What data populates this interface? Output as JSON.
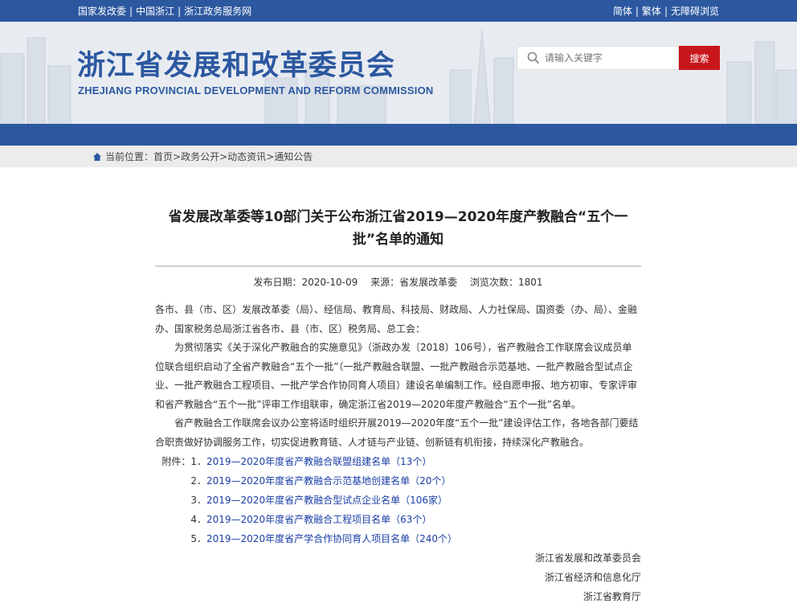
{
  "topbar": {
    "left_links": [
      "国家发改委",
      "中国浙江",
      "浙江政务服务网"
    ],
    "right_links": [
      "简体",
      "繁体",
      "无障碍浏览"
    ]
  },
  "header": {
    "title_cn": "浙江省发展和改革委员会",
    "title_en": "ZHEJIANG PROVINCIAL DEVELOPMENT AND REFORM COMMISSION",
    "search_placeholder": "请输入关键字",
    "search_button": "搜索"
  },
  "breadcrumb": {
    "prefix": "当前位置：",
    "items": [
      "首页",
      "政务公开",
      "动态资讯",
      "通知公告"
    ]
  },
  "article": {
    "title": "省发展改革委等10部门关于公布浙江省2019—2020年度产教融合“五个一批”名单的通知",
    "publish_date": "发布日期：2020-10-09",
    "source": "来源：省发展改革委",
    "views": "浏览次数：1801",
    "p1": "各市、县（市、区）发展改革委（局）、经信局、教育局、科技局、财政局、人力社保局、国资委（办、局）、金融办、国家税务总局浙江省各市、县（市、区）税务局、总工会：",
    "p2": "为贯彻落实《关于深化产教融合的实施意见》（浙政办发〔2018〕106号），省产教融合工作联席会议成员单位联合组织启动了全省产教融合“五个一批”（一批产教融合联盟、一批产教融合示范基地、一批产教融合型试点企业、一批产教融合工程项目、一批产学合作协同育人项目）建设名单编制工作。经自愿申报、地方初审、专家评审和省产教融合“五个一批”评审工作组联审，确定浙江省2019—2020年度产教融合“五个一批”名单。",
    "p3": "省产教融合工作联席会议办公室将适时组织开展2019—2020年度“五个一批”建设评估工作，各地各部门要结合职责做好协调服务工作，切实促进教育链、人才链与产业链、创新链有机衔接，持续深化产教融合。",
    "attach_label": "附件：",
    "attachments": [
      {
        "num": "1．",
        "text": "2019—2020年度省产教融合联盟组建名单（13个）"
      },
      {
        "num": "2．",
        "text": "2019—2020年度省产教融合示范基地创建名单（20个）"
      },
      {
        "num": "3．",
        "text": "2019—2020年度省产教融合型试点企业名单（106家）"
      },
      {
        "num": "4．",
        "text": "2019—2020年度省产教融合工程项目名单（63个）"
      },
      {
        "num": "5．",
        "text": "2019—2020年度省产学合作协同育人项目名单（240个）"
      }
    ],
    "signers": [
      "浙江省发展和改革委员会",
      "浙江省经济和信息化厅",
      "浙江省教育厅"
    ]
  },
  "colors": {
    "brand_blue": "#2c58a0",
    "search_red": "#c8161d",
    "link_blue": "#1a3ea6"
  }
}
